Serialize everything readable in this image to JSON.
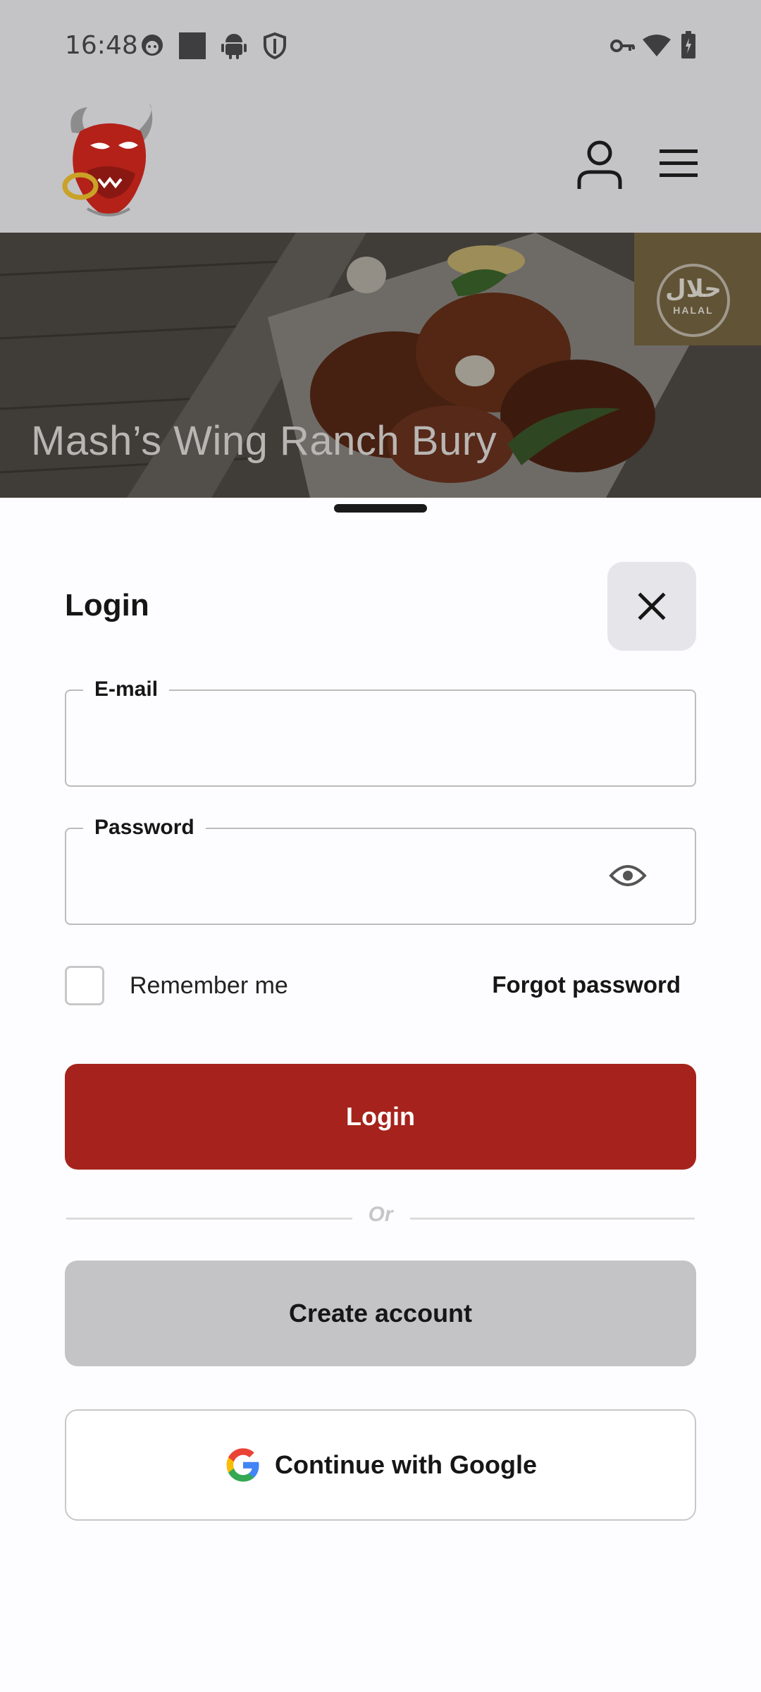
{
  "status_bar": {
    "time": "16:48",
    "icons_left": [
      "face-icon",
      "square-icon",
      "android-icon",
      "shield-icon"
    ],
    "icons_right": [
      "key-icon",
      "wifi-icon",
      "battery-icon"
    ]
  },
  "header": {
    "logo": "bull-logo",
    "account_icon": "person-icon",
    "menu_icon": "hamburger-menu-icon"
  },
  "hero": {
    "title": "Mash’s Wing Ranch Bury",
    "badge_arabic": "حلال",
    "badge_latin": "HALAL"
  },
  "login_sheet": {
    "title": "Login",
    "email": {
      "label": "E-mail",
      "value": "",
      "placeholder": ""
    },
    "password": {
      "label": "Password",
      "value": "",
      "placeholder": ""
    },
    "remember_me": {
      "label": "Remember me",
      "checked": false
    },
    "forgot_password": "Forgot password",
    "login_button": "Login",
    "divider": "Or",
    "create_account_button": "Create account",
    "google_button": "Continue with Google"
  },
  "colors": {
    "primary": "#a5231c",
    "scrim": "#c4c3c6",
    "sheet_bg": "#fdfcfe"
  }
}
